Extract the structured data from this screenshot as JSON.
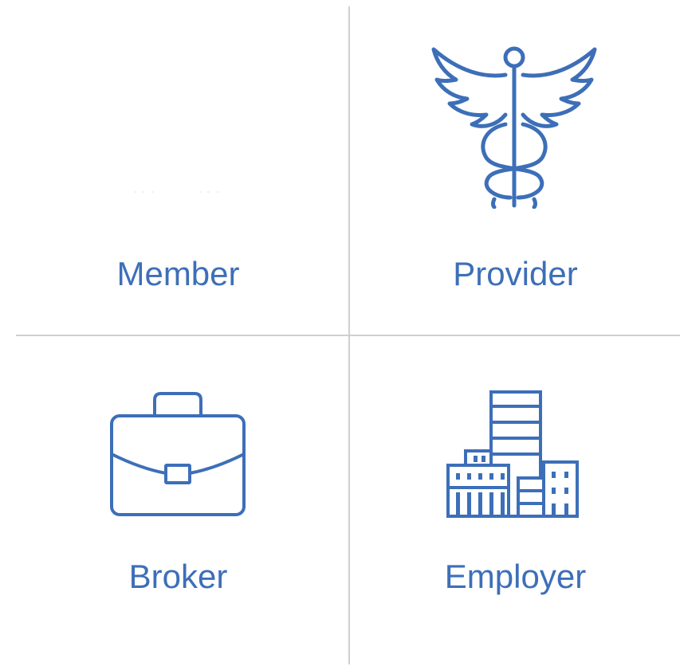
{
  "colors": {
    "accent": "#3d6fb8",
    "divider": "#cfcfcf",
    "background": "#ffffff"
  },
  "tiles": [
    {
      "id": "member",
      "label": "Member",
      "icon": "member-icon"
    },
    {
      "id": "provider",
      "label": "Provider",
      "icon": "caduceus-icon"
    },
    {
      "id": "broker",
      "label": "Broker",
      "icon": "briefcase-icon"
    },
    {
      "id": "employer",
      "label": "Employer",
      "icon": "office-building-icon"
    }
  ]
}
